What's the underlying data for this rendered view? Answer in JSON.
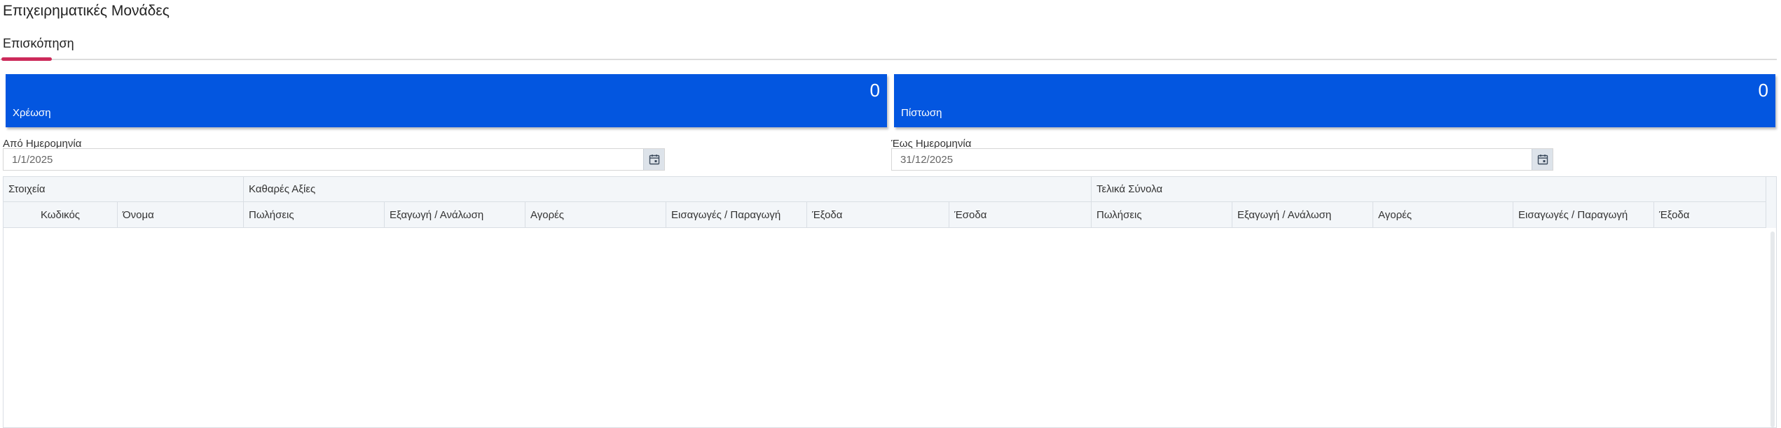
{
  "page": {
    "title": "Επιχειρηματικές Μονάδες"
  },
  "tabs": [
    {
      "label": "Επισκόπηση",
      "active": true
    }
  ],
  "tiles": {
    "debit": {
      "value": "0",
      "label": "Χρέωση"
    },
    "credit": {
      "value": "0",
      "label": "Πίστωση"
    },
    "color": "#0356e0"
  },
  "filters": {
    "from": {
      "label": "Από Ημερομηνία",
      "value": "1/1/2025",
      "icon": "calendar-icon"
    },
    "to": {
      "label": "Έως Ημερομηνία",
      "value": "31/12/2025",
      "icon": "calendar-icon"
    }
  },
  "grid": {
    "groups": [
      "Στοιχεία",
      "Καθαρές Αξίες",
      "Τελικά Σύνολα"
    ],
    "columns": [
      "Κωδικός",
      "Όνομα",
      "Πωλήσεις",
      "Εξαγωγή / Ανάλωση",
      "Αγορές",
      "Εισαγωγές / Παραγωγή",
      "Έξοδα",
      "Έσοδα",
      "Πωλήσεις",
      "Εξαγωγή / Ανάλωση",
      "Αγορές",
      "Εισαγωγές / Παραγωγή",
      "Έξοδα"
    ],
    "rows": []
  },
  "colors": {
    "accent": "#cc2a5a",
    "tile": "#0356e0",
    "header_bg": "#f3f6f9"
  }
}
